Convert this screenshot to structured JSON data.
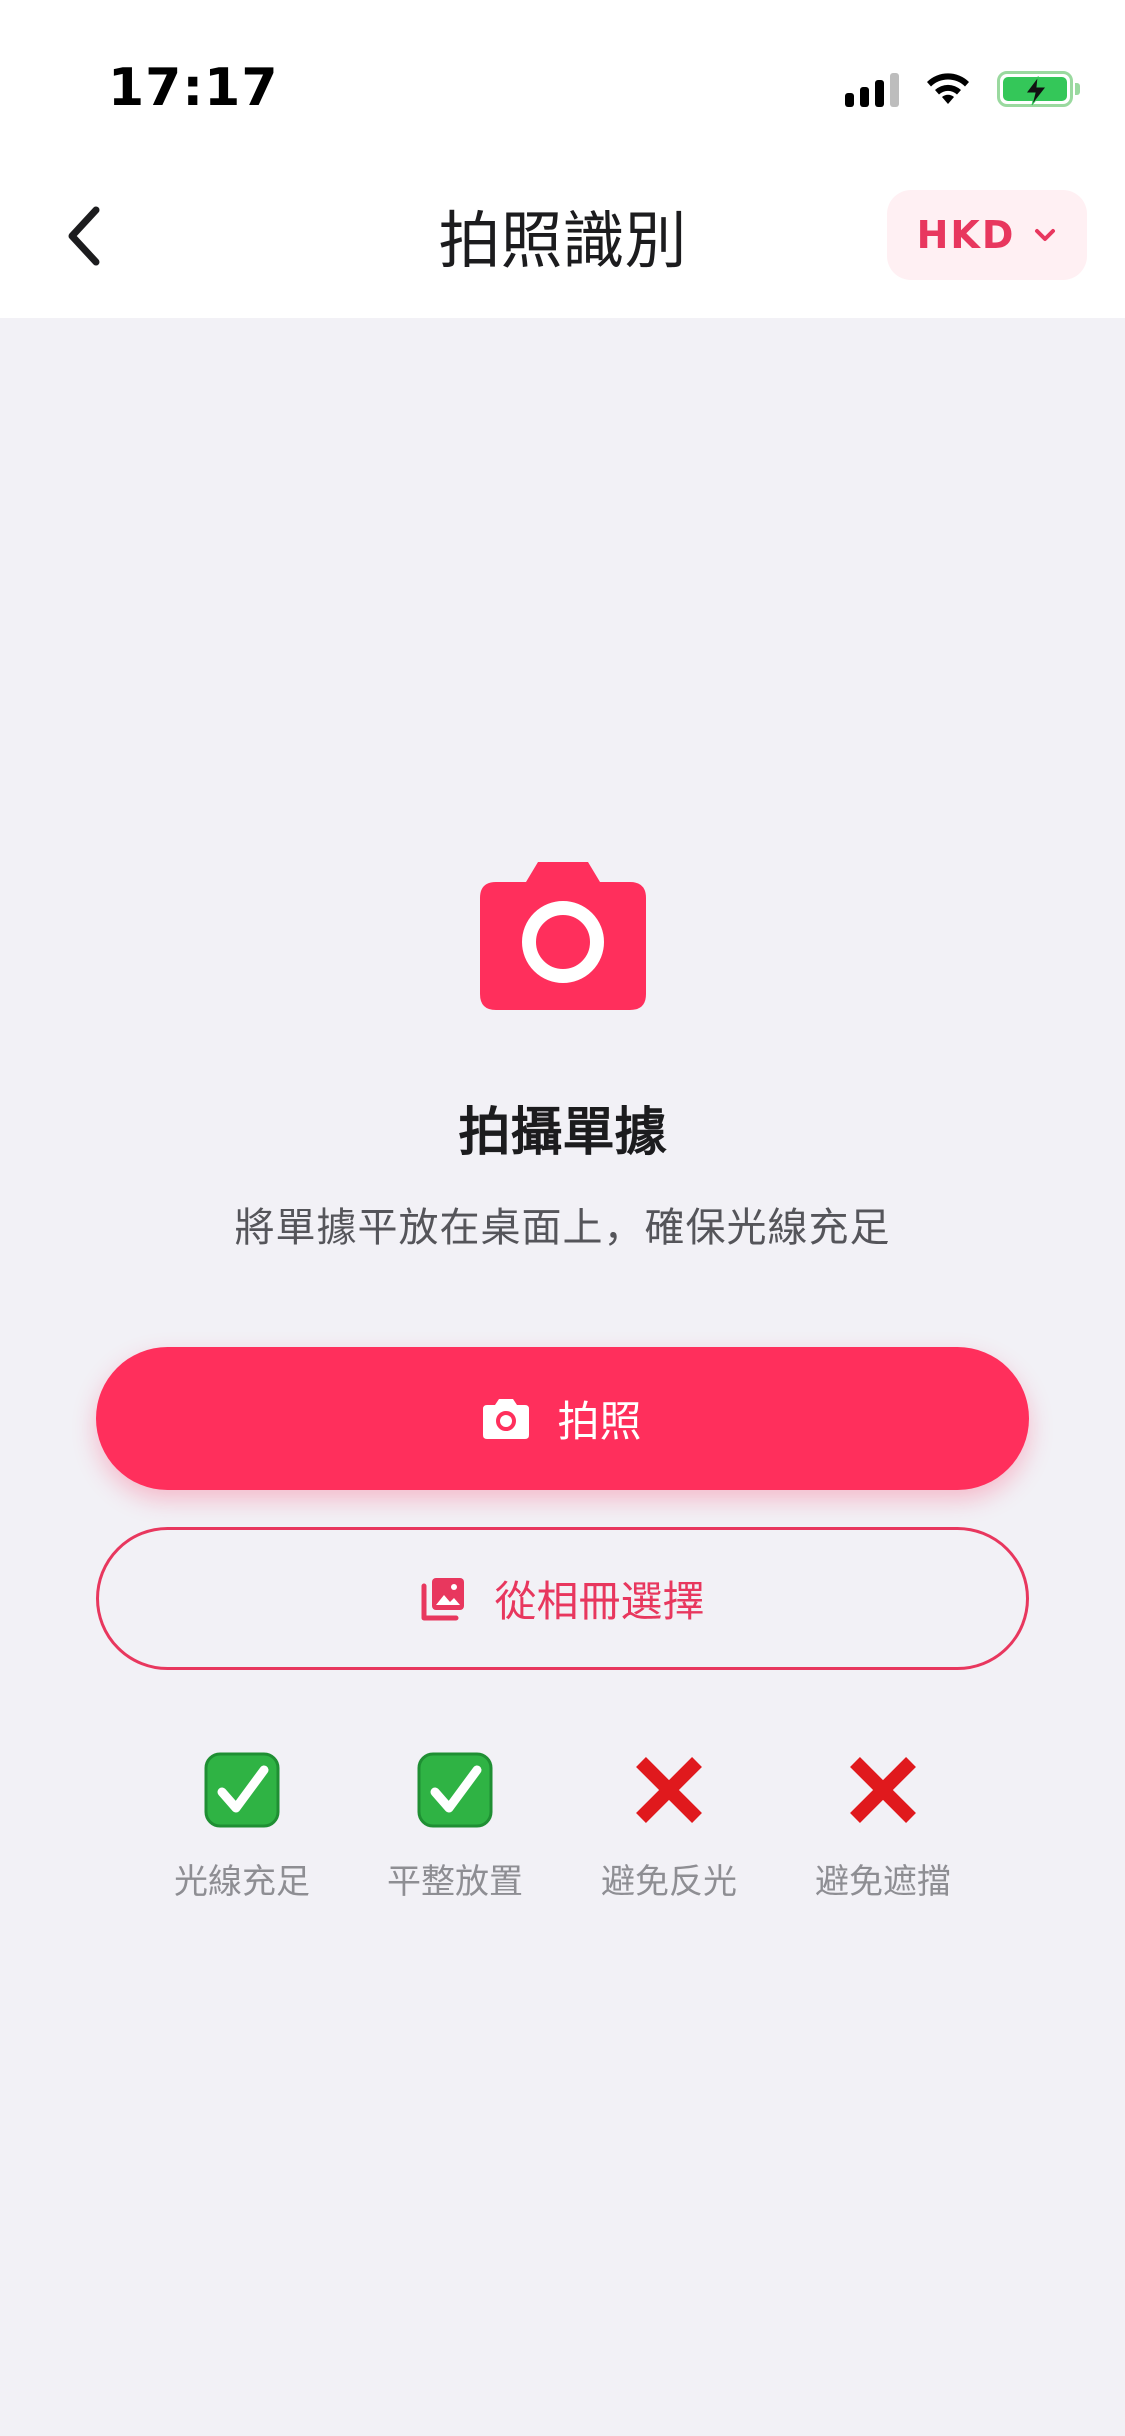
{
  "status_bar": {
    "time": "17:17",
    "icons": [
      "cellular-signal-icon",
      "wifi-icon",
      "battery-charging-icon"
    ]
  },
  "nav": {
    "back_icon": "chevron-left-icon",
    "title": "拍照識別",
    "currency": "HKD",
    "currency_icon": "chevron-down-icon"
  },
  "main": {
    "hero_icon": "camera-icon",
    "heading": "拍攝單據",
    "subtitle": "將單據平放在桌面上，確保光線充足",
    "take_photo_label": "拍照",
    "take_photo_icon": "camera-icon",
    "album_label": "從相冊選擇",
    "album_icon": "photo-library-icon"
  },
  "tips": [
    {
      "label": "光線充足",
      "status": "ok",
      "icon": "check-mark-icon"
    },
    {
      "label": "平整放置",
      "status": "ok",
      "icon": "check-mark-icon"
    },
    {
      "label": "避免反光",
      "status": "avoid",
      "icon": "cross-mark-icon"
    },
    {
      "label": "避免遮擋",
      "status": "avoid",
      "icon": "cross-mark-icon"
    }
  ],
  "colors": {
    "accent": "#ff2f5c",
    "accent_text": "#e8375e",
    "background": "#f2f1f6",
    "check_green": "#2fb344",
    "cross_red": "#e0191d"
  }
}
